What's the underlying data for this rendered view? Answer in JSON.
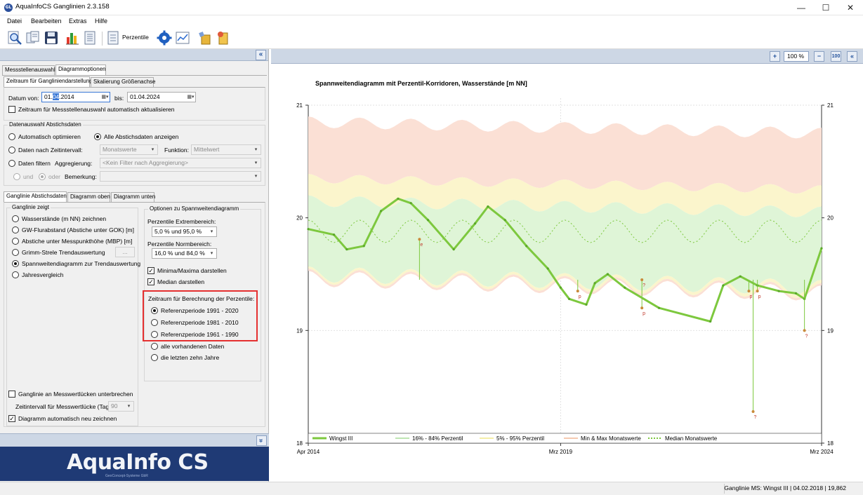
{
  "window": {
    "title": "AquaInfoCS Ganglinien 2.3.158",
    "icon_text": "GL",
    "controls": {
      "minimize": "—",
      "maximize": "☐",
      "close": "✕"
    }
  },
  "menu": [
    "Datei",
    "Bearbeiten",
    "Extras",
    "Hilfe"
  ],
  "toolbar": {
    "perzentile_label": "Perzentile"
  },
  "left": {
    "main_tabs": [
      "Messstellenauswahl",
      "Diagrammoptionen"
    ],
    "sub_tabs": [
      "Zeitraum für Gangliniendarstellung",
      "Skalierung Größenachse"
    ],
    "datum_von_label": "Datum von:",
    "datum_von_a": "01.",
    "datum_von_sel": "04",
    "datum_von_b": ".2014",
    "bis_label": "bis:",
    "datum_bis": "01.04.2024",
    "auto_update_label": "Zeitraum für Messstellenauswahl automatisch aktualisieren",
    "datenauswahl_title": "Datenauswahl Abstichsdaten",
    "auto_opt": "Automatisch optimieren",
    "alle_anzeigen": "Alle Abstichsdaten anzeigen",
    "nach_intervall": "Daten nach Zeitintervall:",
    "intervall_value": "Monatswerte",
    "funktion_label": "Funktion:",
    "funktion_value": "Mittelwert",
    "daten_filtern": "Daten filtern",
    "aggregierung_label": "Aggregierung:",
    "aggregierung_value": "<Kein Filter nach Aggregierung>",
    "und": "und",
    "oder": "oder",
    "bemerkung_label": "Bemerkung:",
    "ganglinie_tabs": [
      "Ganglinie Abstichsdaten",
      "Diagramm oben",
      "Diagramm unten"
    ],
    "ganglinie_zeigt_title": "Ganglinie zeigt",
    "ganglinie_options": [
      "Wasserstände (m NN) zeichnen",
      "GW-Flurabstand (Abstiche unter GOK) [m]",
      "Abstiche unter Messpunkthöhe (MBP) [m]",
      "Grimm-Strele Trendauswertung",
      "Spannweitendiagramm zur Trendauswertung",
      "Jahresvergleich"
    ],
    "grimm_button": "...",
    "optionen_title": "Optionen zu Spannweitendiagramm",
    "extrem_label": "Perzentile Extrembereich:",
    "extrem_value": "5,0 %  und   95,0 %",
    "normal_label": "Perzentile Normbereich:",
    "normal_value": "16,0 %  und   84,0 %",
    "minmax_label": "Minima/Maxima darstellen",
    "median_label": "Median darstellen",
    "zeitraum_perz_label": "Zeitraum für Berechnung der Perzentile:",
    "referenz_options": [
      "Referenzperiode 1991 - 2020",
      "Referenzperiode 1981 - 2010",
      "Referenzperiode 1961 - 1990",
      "alle vorhandenen Daten",
      "die letzten zehn Jahre"
    ],
    "luecken_label": "Ganglinie an Messwertlücken unterbrechen",
    "zeitintervall_label": "Zeitintervall für Messwertlücke (Tage)",
    "zeitintervall_value": "90",
    "auto_zeichnen_label": "Diagramm automatisch neu zeichnen",
    "logo_text": "AquaInfo CS",
    "logo_sub": "GeoConcept-Systeme GbR"
  },
  "right": {
    "zoom": "100 %",
    "btn_plus": "+",
    "btn_minus": "−",
    "btn_fit": "100",
    "btn_collapse": "«"
  },
  "status": "Ganglinie MS: Wingst III | 04.02.2018 | 19,862",
  "colors": {
    "accent": "#1f4f9a",
    "highlight": "#e53030",
    "series": "#7dc83e"
  },
  "chart_data": {
    "type": "line",
    "title": "Spannweitendiagramm mit Perzentil-Korridoren, Wasserstände [m NN]",
    "ylim": [
      18,
      21
    ],
    "yticks": [
      "21",
      "20",
      "19",
      "18"
    ],
    "xlim": [
      "2014-04",
      "2024-04"
    ],
    "xticks": [
      "Apr 2014",
      "Mrz 2019",
      "Mrz 2024"
    ],
    "legend": [
      "Wingst III",
      "16% - 84% Perzentil",
      "5% - 95% Perzentil",
      "Min & Max Monatswerte",
      "Median Monatswerte"
    ],
    "legend_position": "bottom",
    "bands": {
      "max": [
        20.85,
        20.75
      ],
      "p95": [
        20.35,
        20.25
      ],
      "p84": [
        20.15,
        20.05
      ],
      "p16": [
        19.5,
        19.38
      ],
      "p5": [
        19.48,
        19.35
      ],
      "min": [
        19.46,
        19.33
      ]
    },
    "series": [
      {
        "name": "Wingst III",
        "x": [
          "2014-04",
          "2014-10",
          "2015-01",
          "2015-05",
          "2015-09",
          "2016-01",
          "2016-04",
          "2016-08",
          "2017-02",
          "2017-07",
          "2017-10",
          "2018-02",
          "2018-07",
          "2018-12",
          "2019-03",
          "2019-05",
          "2019-09",
          "2019-11",
          "2020-02",
          "2020-06",
          "2021-02",
          "2022-02",
          "2022-05",
          "2022-09",
          "2023-01",
          "2023-06",
          "2023-10",
          "2023-12",
          "2024-04"
        ],
        "values": [
          19.9,
          19.85,
          19.72,
          19.75,
          20.06,
          20.17,
          20.13,
          19.98,
          19.72,
          19.95,
          20.1,
          19.98,
          19.75,
          19.55,
          19.38,
          19.28,
          19.23,
          19.42,
          19.5,
          19.38,
          19.2,
          19.08,
          19.4,
          19.48,
          19.4,
          19.35,
          19.33,
          19.28,
          19.73
        ]
      },
      {
        "name": "Median Monatswerte",
        "values": [
          19.92,
          19.78,
          19.85,
          19.92,
          20.0,
          19.7,
          19.9,
          19.95,
          19.75,
          19.72,
          19.92,
          19.98,
          19.72,
          19.75
        ]
      }
    ],
    "outliers": [
      {
        "x": "2016-06",
        "y": 19.81,
        "label": "e"
      },
      {
        "x": "2019-07",
        "y": 19.35,
        "label": "p"
      },
      {
        "x": "2020-10",
        "y": 19.2,
        "label": "p"
      },
      {
        "x": "2020-10",
        "y": 19.45,
        "label": "?"
      },
      {
        "x": "2022-11",
        "y": 19.35,
        "label": "p"
      },
      {
        "x": "2022-12",
        "y": 18.28,
        "label": "?"
      },
      {
        "x": "2023-01",
        "y": 19.35,
        "label": "p"
      },
      {
        "x": "2023-12",
        "y": 19.0,
        "label": "?"
      }
    ]
  }
}
